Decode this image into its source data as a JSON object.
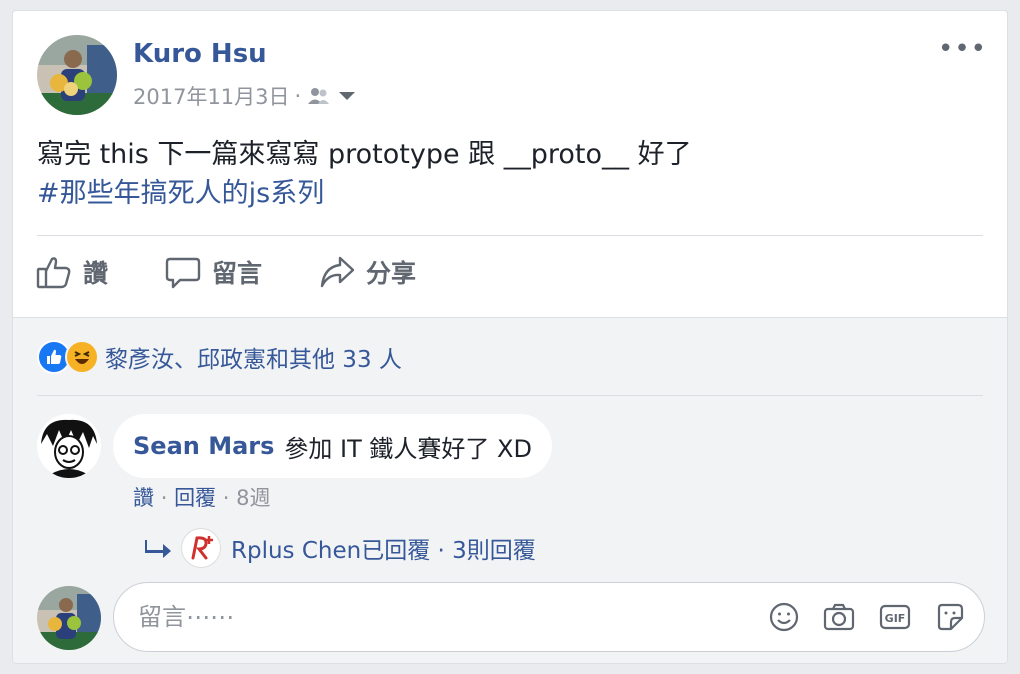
{
  "post": {
    "author": "Kuro Hsu",
    "date": "2017年11月3日",
    "dot": "·",
    "more": "•••",
    "text_line1": "寫完 this 下一篇來寫寫 prototype 跟 __proto__ 好了",
    "hashtag": "#那些年搞死人的js系列"
  },
  "actions": {
    "like": "讚",
    "comment": "留言",
    "share": "分享"
  },
  "reactions": {
    "text": "黎彥汝、邱政憲和其他 33 人"
  },
  "comment": {
    "name": "Sean Mars",
    "text": "參加 IT 鐵人賽好了 XD",
    "like": "讚",
    "dot": "·",
    "reply": "回覆",
    "time": "8週"
  },
  "reply": {
    "text": "Rplus Chen已回覆 · 3則回覆"
  },
  "composer": {
    "placeholder": "留言⋯⋯"
  },
  "colors": {
    "link": "#365899",
    "muted": "#90949c",
    "like_blue": "#1877f2",
    "haha_yellow": "#f7b125"
  }
}
